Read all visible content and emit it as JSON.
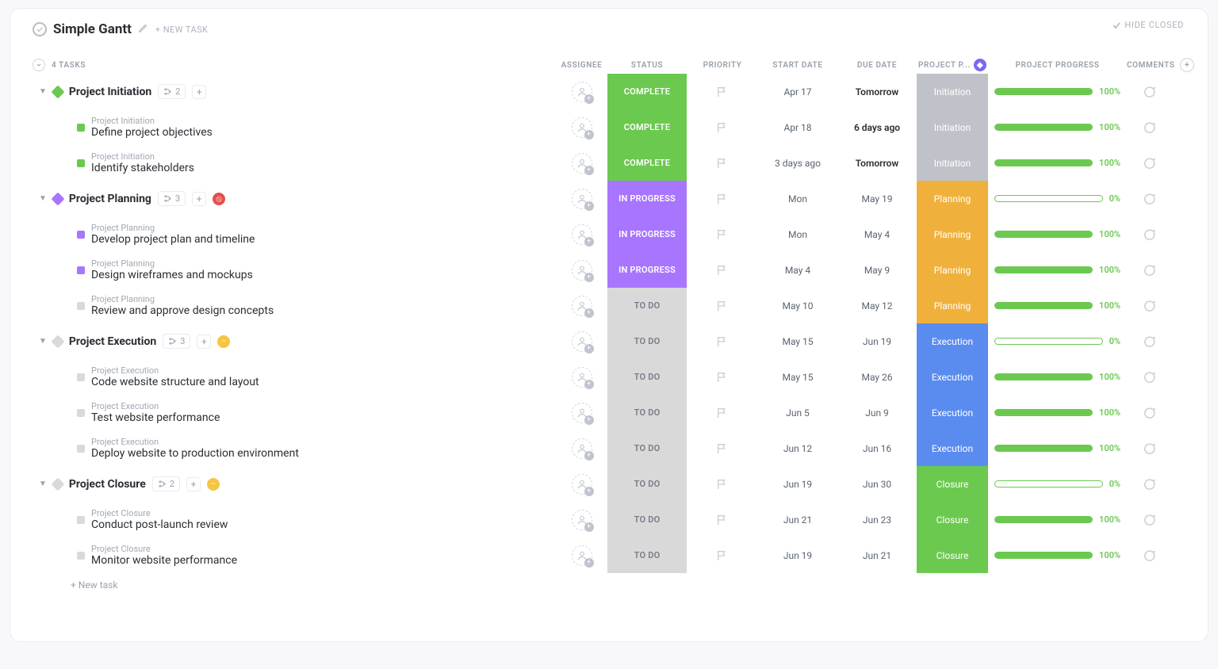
{
  "header": {
    "title": "Simple Gantt",
    "new_task_label": "+ NEW TASK",
    "hide_closed": "HIDE CLOSED",
    "task_count": "4 TASKS"
  },
  "columns": {
    "assignee": "ASSIGNEE",
    "status": "STATUS",
    "priority": "PRIORITY",
    "start_date": "START DATE",
    "due_date": "DUE DATE",
    "phase": "PROJECT P...",
    "progress": "PROJECT PROGRESS",
    "comments": "COMMENTS"
  },
  "new_task_row": "+ New task",
  "groups": [
    {
      "name": "Project Initiation",
      "color": "#6bc950",
      "subtasks_count": "2",
      "extra": null,
      "status": "COMPLETE",
      "status_class": "complete",
      "start": "Apr 17",
      "due": "Tomorrow",
      "due_bold": true,
      "phase": "Initiation",
      "phase_class": "initiation",
      "progress": 100,
      "progress_label": "100%",
      "children": [
        {
          "crumb": "Project Initiation",
          "label": "Define project objectives",
          "square": "#6bc950",
          "status": "COMPLETE",
          "status_class": "complete",
          "start": "Apr 18",
          "due": "6 days ago",
          "due_bold": true,
          "phase": "Initiation",
          "phase_class": "initiation",
          "progress": 100,
          "progress_label": "100%"
        },
        {
          "crumb": "Project Initiation",
          "label": "Identify stakeholders",
          "square": "#6bc950",
          "status": "COMPLETE",
          "status_class": "complete",
          "start": "3 days ago",
          "due": "Tomorrow",
          "due_bold": true,
          "phase": "Initiation",
          "phase_class": "initiation",
          "progress": 100,
          "progress_label": "100%"
        }
      ]
    },
    {
      "name": "Project Planning",
      "color": "#a875ff",
      "subtasks_count": "3",
      "extra": "red",
      "status": "IN PROGRESS",
      "status_class": "inprogress",
      "start": "Mon",
      "due": "May 19",
      "due_bold": false,
      "phase": "Planning",
      "phase_class": "planning",
      "progress": 0,
      "progress_label": "0%",
      "children": [
        {
          "crumb": "Project Planning",
          "label": "Develop project plan and timeline",
          "square": "#a875ff",
          "status": "IN PROGRESS",
          "status_class": "inprogress",
          "start": "Mon",
          "due": "May 4",
          "due_bold": false,
          "phase": "Planning",
          "phase_class": "planning",
          "progress": 100,
          "progress_label": "100%"
        },
        {
          "crumb": "Project Planning",
          "label": "Design wireframes and mockups",
          "square": "#a875ff",
          "status": "IN PROGRESS",
          "status_class": "inprogress",
          "start": "May 4",
          "due": "May 9",
          "due_bold": false,
          "phase": "Planning",
          "phase_class": "planning",
          "progress": 100,
          "progress_label": "100%"
        },
        {
          "crumb": "Project Planning",
          "label": "Review and approve design concepts",
          "square": "#d9d9d9",
          "status": "TO DO",
          "status_class": "todo",
          "start": "May 10",
          "due": "May 12",
          "due_bold": false,
          "phase": "Planning",
          "phase_class": "planning",
          "progress": 100,
          "progress_label": "100%"
        }
      ]
    },
    {
      "name": "Project Execution",
      "color": "#d9d9d9",
      "subtasks_count": "3",
      "extra": "yellow",
      "status": "TO DO",
      "status_class": "todo",
      "start": "May 15",
      "due": "Jun 19",
      "due_bold": false,
      "phase": "Execution",
      "phase_class": "execution",
      "progress": 0,
      "progress_label": "0%",
      "children": [
        {
          "crumb": "Project Execution",
          "label": "Code website structure and layout",
          "square": "#d9d9d9",
          "status": "TO DO",
          "status_class": "todo",
          "start": "May 15",
          "due": "May 26",
          "due_bold": false,
          "phase": "Execution",
          "phase_class": "execution",
          "progress": 100,
          "progress_label": "100%"
        },
        {
          "crumb": "Project Execution",
          "label": "Test website performance",
          "square": "#d9d9d9",
          "status": "TO DO",
          "status_class": "todo",
          "start": "Jun 5",
          "due": "Jun 9",
          "due_bold": false,
          "phase": "Execution",
          "phase_class": "execution",
          "progress": 100,
          "progress_label": "100%"
        },
        {
          "crumb": "Project Execution",
          "label": "Deploy website to production environment",
          "square": "#d9d9d9",
          "status": "TO DO",
          "status_class": "todo",
          "start": "Jun 12",
          "due": "Jun 16",
          "due_bold": false,
          "phase": "Execution",
          "phase_class": "execution",
          "progress": 100,
          "progress_label": "100%"
        }
      ]
    },
    {
      "name": "Project Closure",
      "color": "#d9d9d9",
      "subtasks_count": "2",
      "extra": "yellow",
      "status": "TO DO",
      "status_class": "todo",
      "start": "Jun 19",
      "due": "Jun 30",
      "due_bold": false,
      "phase": "Closure",
      "phase_class": "closure",
      "progress": 0,
      "progress_label": "0%",
      "children": [
        {
          "crumb": "Project Closure",
          "label": "Conduct post-launch review",
          "square": "#d9d9d9",
          "status": "TO DO",
          "status_class": "todo",
          "start": "Jun 21",
          "due": "Jun 23",
          "due_bold": false,
          "phase": "Closure",
          "phase_class": "closure",
          "progress": 100,
          "progress_label": "100%"
        },
        {
          "crumb": "Project Closure",
          "label": "Monitor website performance",
          "square": "#d9d9d9",
          "status": "TO DO",
          "status_class": "todo",
          "start": "Jun 19",
          "due": "Jun 21",
          "due_bold": false,
          "phase": "Closure",
          "phase_class": "closure",
          "progress": 100,
          "progress_label": "100%"
        }
      ]
    }
  ]
}
